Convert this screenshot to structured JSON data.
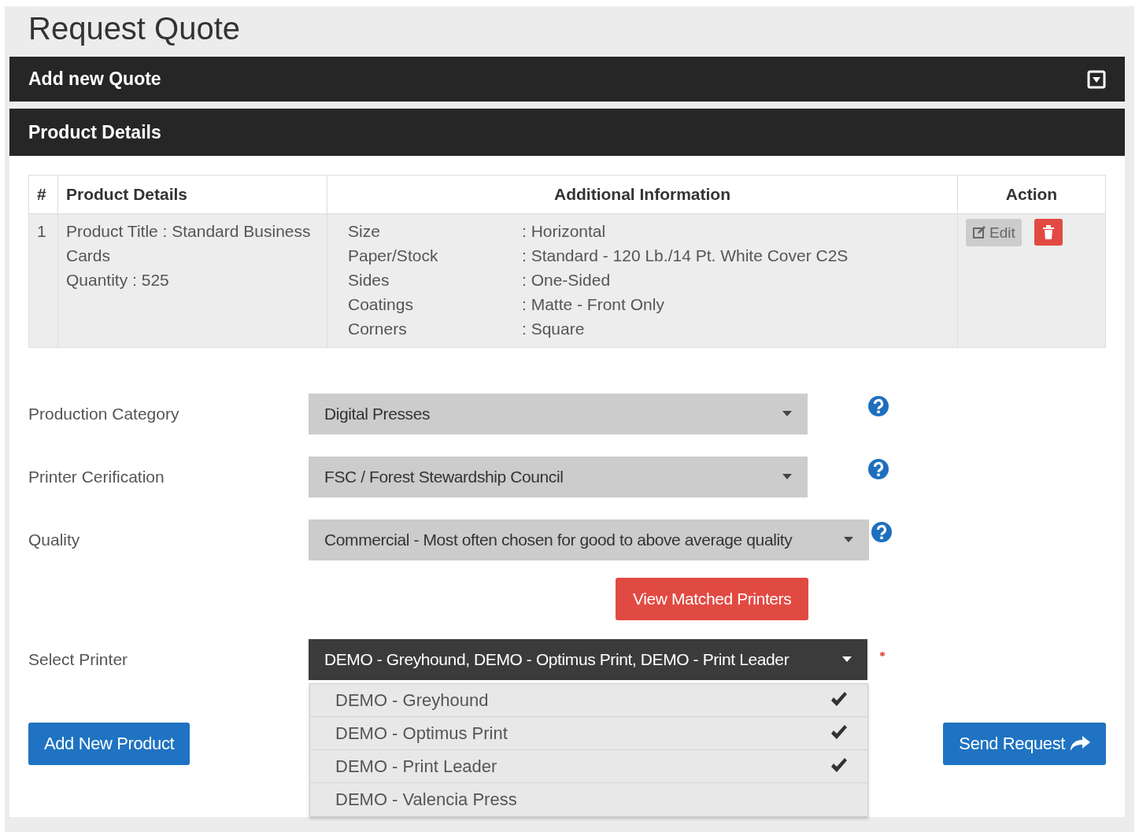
{
  "page_title": "Request Quote",
  "panels": [
    {
      "title": "Add new Quote",
      "collapsible": true
    },
    {
      "title": "Product Details",
      "collapsible": false
    }
  ],
  "table": {
    "columns": [
      "#",
      "Product Details",
      "Additional Information",
      "Action"
    ],
    "rows": [
      {
        "index": "1",
        "product_lines": [
          "Product Title : Standard Business Cards",
          "Quantity : 525"
        ],
        "attributes": [
          {
            "label": "Size",
            "value": ": Horizontal"
          },
          {
            "label": "Paper/Stock",
            "value": ": Standard - 120 Lb./14 Pt. White Cover C2S"
          },
          {
            "label": "Sides",
            "value": ": One-Sided"
          },
          {
            "label": "Coatings",
            "value": ": Matte - Front Only"
          },
          {
            "label": "Corners",
            "value": ": Square"
          }
        ],
        "actions": [
          {
            "kind": "edit",
            "label": "Edit"
          },
          {
            "kind": "delete"
          }
        ]
      }
    ]
  },
  "fields": [
    {
      "label": "Production Category",
      "value": "Digital Presses",
      "help": true,
      "wide": false
    },
    {
      "label": "Printer Cerification",
      "value": "FSC / Forest Stewardship Council",
      "help": true,
      "wide": false
    },
    {
      "label": "Quality",
      "value": "Commercial - Most often chosen for good to above average quality",
      "help": true,
      "wide": true
    }
  ],
  "view_button": "View Matched Printers",
  "printer_field": {
    "label": "Select Printer",
    "value": "DEMO - Greyhound, DEMO - Optimus Print, DEMO - Print Leader",
    "required": true,
    "expanded": true,
    "options": [
      {
        "label": "DEMO - Greyhound",
        "checked": true
      },
      {
        "label": "DEMO - Optimus Print",
        "checked": true
      },
      {
        "label": "DEMO - Print Leader",
        "checked": true
      },
      {
        "label": "DEMO - Valencia Press",
        "checked": false
      }
    ]
  },
  "buttons": {
    "add": "Add New Product",
    "send": "Send Request"
  }
}
